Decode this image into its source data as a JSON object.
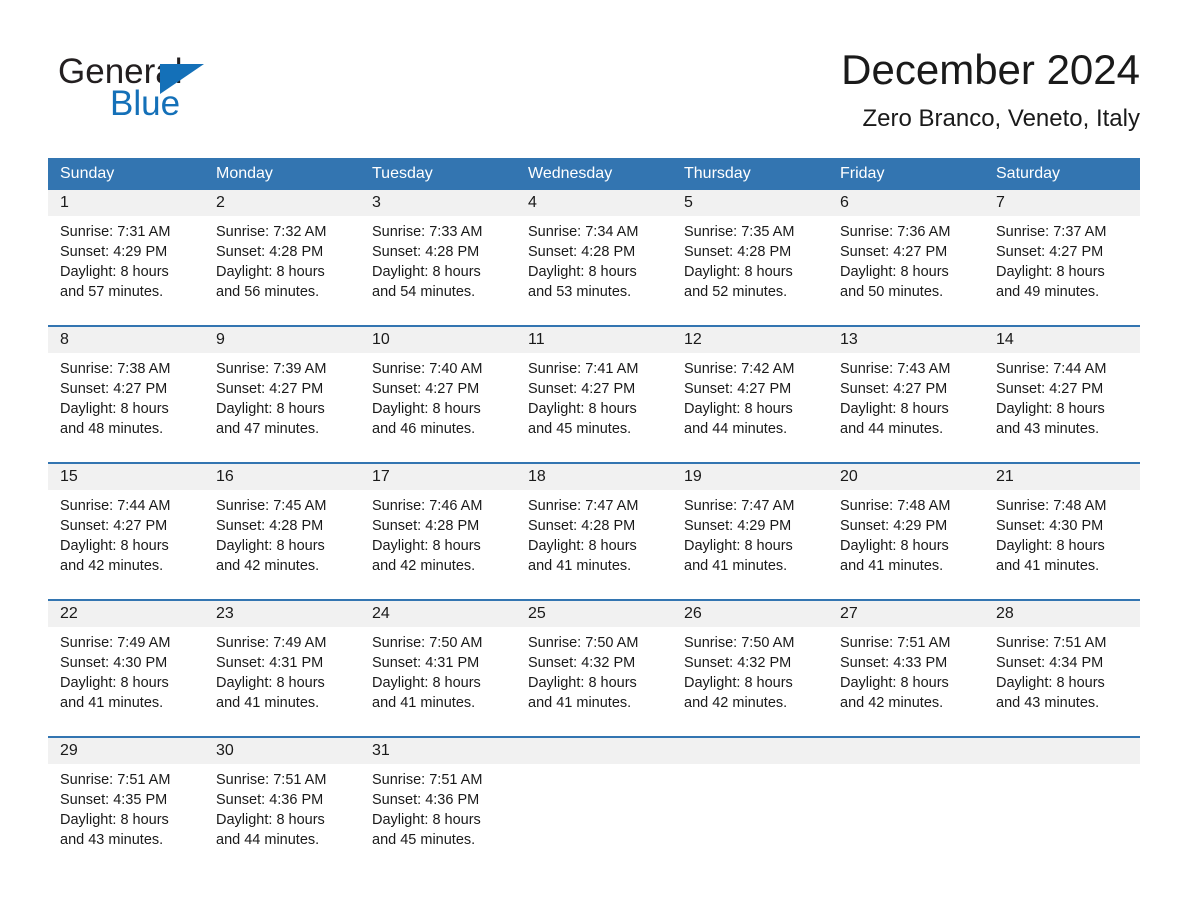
{
  "brand": {
    "name_part1": "General",
    "name_part2": "Blue",
    "logo_icon": "triangle-icon",
    "accent_color": "#1470b8"
  },
  "header": {
    "title": "December 2024",
    "subtitle": "Zero Branco, Veneto, Italy"
  },
  "theme": {
    "header_blue": "#3375b1",
    "daynum_band": "#f1f1f1",
    "text": "#1a1a1a"
  },
  "calendar": {
    "weekdays": [
      "Sunday",
      "Monday",
      "Tuesday",
      "Wednesday",
      "Thursday",
      "Friday",
      "Saturday"
    ],
    "weeks": [
      [
        {
          "day": "1",
          "lines": [
            "Sunrise: 7:31 AM",
            "Sunset: 4:29 PM",
            "Daylight: 8 hours",
            "and 57 minutes."
          ]
        },
        {
          "day": "2",
          "lines": [
            "Sunrise: 7:32 AM",
            "Sunset: 4:28 PM",
            "Daylight: 8 hours",
            "and 56 minutes."
          ]
        },
        {
          "day": "3",
          "lines": [
            "Sunrise: 7:33 AM",
            "Sunset: 4:28 PM",
            "Daylight: 8 hours",
            "and 54 minutes."
          ]
        },
        {
          "day": "4",
          "lines": [
            "Sunrise: 7:34 AM",
            "Sunset: 4:28 PM",
            "Daylight: 8 hours",
            "and 53 minutes."
          ]
        },
        {
          "day": "5",
          "lines": [
            "Sunrise: 7:35 AM",
            "Sunset: 4:28 PM",
            "Daylight: 8 hours",
            "and 52 minutes."
          ]
        },
        {
          "day": "6",
          "lines": [
            "Sunrise: 7:36 AM",
            "Sunset: 4:27 PM",
            "Daylight: 8 hours",
            "and 50 minutes."
          ]
        },
        {
          "day": "7",
          "lines": [
            "Sunrise: 7:37 AM",
            "Sunset: 4:27 PM",
            "Daylight: 8 hours",
            "and 49 minutes."
          ]
        }
      ],
      [
        {
          "day": "8",
          "lines": [
            "Sunrise: 7:38 AM",
            "Sunset: 4:27 PM",
            "Daylight: 8 hours",
            "and 48 minutes."
          ]
        },
        {
          "day": "9",
          "lines": [
            "Sunrise: 7:39 AM",
            "Sunset: 4:27 PM",
            "Daylight: 8 hours",
            "and 47 minutes."
          ]
        },
        {
          "day": "10",
          "lines": [
            "Sunrise: 7:40 AM",
            "Sunset: 4:27 PM",
            "Daylight: 8 hours",
            "and 46 minutes."
          ]
        },
        {
          "day": "11",
          "lines": [
            "Sunrise: 7:41 AM",
            "Sunset: 4:27 PM",
            "Daylight: 8 hours",
            "and 45 minutes."
          ]
        },
        {
          "day": "12",
          "lines": [
            "Sunrise: 7:42 AM",
            "Sunset: 4:27 PM",
            "Daylight: 8 hours",
            "and 44 minutes."
          ]
        },
        {
          "day": "13",
          "lines": [
            "Sunrise: 7:43 AM",
            "Sunset: 4:27 PM",
            "Daylight: 8 hours",
            "and 44 minutes."
          ]
        },
        {
          "day": "14",
          "lines": [
            "Sunrise: 7:44 AM",
            "Sunset: 4:27 PM",
            "Daylight: 8 hours",
            "and 43 minutes."
          ]
        }
      ],
      [
        {
          "day": "15",
          "lines": [
            "Sunrise: 7:44 AM",
            "Sunset: 4:27 PM",
            "Daylight: 8 hours",
            "and 42 minutes."
          ]
        },
        {
          "day": "16",
          "lines": [
            "Sunrise: 7:45 AM",
            "Sunset: 4:28 PM",
            "Daylight: 8 hours",
            "and 42 minutes."
          ]
        },
        {
          "day": "17",
          "lines": [
            "Sunrise: 7:46 AM",
            "Sunset: 4:28 PM",
            "Daylight: 8 hours",
            "and 42 minutes."
          ]
        },
        {
          "day": "18",
          "lines": [
            "Sunrise: 7:47 AM",
            "Sunset: 4:28 PM",
            "Daylight: 8 hours",
            "and 41 minutes."
          ]
        },
        {
          "day": "19",
          "lines": [
            "Sunrise: 7:47 AM",
            "Sunset: 4:29 PM",
            "Daylight: 8 hours",
            "and 41 minutes."
          ]
        },
        {
          "day": "20",
          "lines": [
            "Sunrise: 7:48 AM",
            "Sunset: 4:29 PM",
            "Daylight: 8 hours",
            "and 41 minutes."
          ]
        },
        {
          "day": "21",
          "lines": [
            "Sunrise: 7:48 AM",
            "Sunset: 4:30 PM",
            "Daylight: 8 hours",
            "and 41 minutes."
          ]
        }
      ],
      [
        {
          "day": "22",
          "lines": [
            "Sunrise: 7:49 AM",
            "Sunset: 4:30 PM",
            "Daylight: 8 hours",
            "and 41 minutes."
          ]
        },
        {
          "day": "23",
          "lines": [
            "Sunrise: 7:49 AM",
            "Sunset: 4:31 PM",
            "Daylight: 8 hours",
            "and 41 minutes."
          ]
        },
        {
          "day": "24",
          "lines": [
            "Sunrise: 7:50 AM",
            "Sunset: 4:31 PM",
            "Daylight: 8 hours",
            "and 41 minutes."
          ]
        },
        {
          "day": "25",
          "lines": [
            "Sunrise: 7:50 AM",
            "Sunset: 4:32 PM",
            "Daylight: 8 hours",
            "and 41 minutes."
          ]
        },
        {
          "day": "26",
          "lines": [
            "Sunrise: 7:50 AM",
            "Sunset: 4:32 PM",
            "Daylight: 8 hours",
            "and 42 minutes."
          ]
        },
        {
          "day": "27",
          "lines": [
            "Sunrise: 7:51 AM",
            "Sunset: 4:33 PM",
            "Daylight: 8 hours",
            "and 42 minutes."
          ]
        },
        {
          "day": "28",
          "lines": [
            "Sunrise: 7:51 AM",
            "Sunset: 4:34 PM",
            "Daylight: 8 hours",
            "and 43 minutes."
          ]
        }
      ],
      [
        {
          "day": "29",
          "lines": [
            "Sunrise: 7:51 AM",
            "Sunset: 4:35 PM",
            "Daylight: 8 hours",
            "and 43 minutes."
          ]
        },
        {
          "day": "30",
          "lines": [
            "Sunrise: 7:51 AM",
            "Sunset: 4:36 PM",
            "Daylight: 8 hours",
            "and 44 minutes."
          ]
        },
        {
          "day": "31",
          "lines": [
            "Sunrise: 7:51 AM",
            "Sunset: 4:36 PM",
            "Daylight: 8 hours",
            "and 45 minutes."
          ]
        },
        {
          "day": "",
          "lines": []
        },
        {
          "day": "",
          "lines": []
        },
        {
          "day": "",
          "lines": []
        },
        {
          "day": "",
          "lines": []
        }
      ]
    ]
  }
}
